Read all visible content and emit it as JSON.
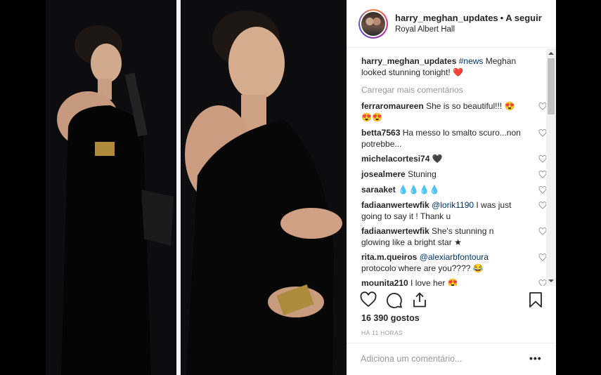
{
  "post": {
    "username": "harry_meghan_updates",
    "follow_separator": "•",
    "follow_label": "A seguir",
    "location": "Royal Albert Hall"
  },
  "caption": {
    "username": "harry_meghan_updates",
    "hashtag": "#news",
    "text": " Meghan looked stunning tonight! ❤️"
  },
  "load_more_label": "Carregar mais comentários",
  "comments": [
    {
      "user": "ferraromaureen",
      "mention": "",
      "text": "She is so beautiful!!! 😍😍😍"
    },
    {
      "user": "betta7563",
      "mention": "",
      "text": "Ha messo lo smalto scuro...non potrebbe..."
    },
    {
      "user": "michelacortesi74",
      "mention": "",
      "text": "🖤"
    },
    {
      "user": "josealmere",
      "mention": "",
      "text": "Stuning"
    },
    {
      "user": "saraaket",
      "mention": "",
      "text": "💧💧💧💧"
    },
    {
      "user": "fadiaanwertewfik",
      "mention": "@lorik1190",
      "text": " I was just going to say it ! Thank u"
    },
    {
      "user": "fadiaanwertewfik",
      "mention": "",
      "text": "She's stunning n glowing like a bright star ★"
    },
    {
      "user": "rita.m.queiros",
      "mention": "@alexiarbfontoura",
      "text": " protocolo where are you???? 😂"
    },
    {
      "user": "mounita210",
      "mention": "",
      "text": "I love her 😍"
    }
  ],
  "likes_label": "16 390 gostos",
  "time_label": "HÁ 11 HORAS",
  "add_comment_placeholder": "Adiciona um comentário...",
  "more_options_label": "•••",
  "icons": {
    "like": "heart-icon",
    "comment": "comment-icon",
    "share": "share-icon",
    "save": "bookmark-icon"
  },
  "colors": {
    "link": "#003569",
    "muted": "#999999",
    "text": "#262626"
  }
}
